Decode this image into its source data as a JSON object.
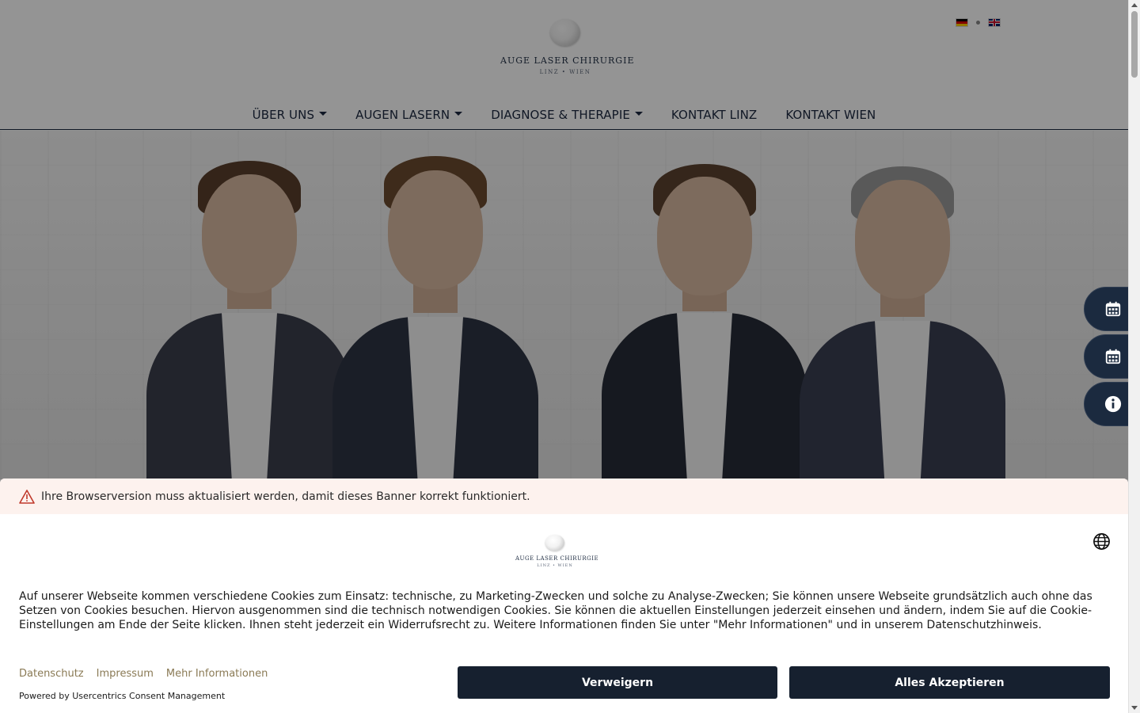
{
  "header": {
    "logo_title": "AUGE LASER CHIRURGIE",
    "logo_subtitle": "LINZ • WIEN",
    "languages": [
      {
        "code": "de",
        "icon": "german-flag-icon"
      },
      {
        "code": "en",
        "icon": "uk-flag-icon"
      }
    ]
  },
  "nav": {
    "items": [
      {
        "label": "ÜBER UNS",
        "dropdown": true
      },
      {
        "label": "AUGEN LASERN",
        "dropdown": true
      },
      {
        "label": "DIAGNOSE & THERAPIE",
        "dropdown": true
      },
      {
        "label": "KONTAKT LINZ",
        "dropdown": false
      },
      {
        "label": "KONTAKT WIEN",
        "dropdown": false
      }
    ]
  },
  "side_buttons": [
    {
      "icon": "calendar-icon"
    },
    {
      "icon": "calendar-icon"
    },
    {
      "icon": "info-icon"
    }
  ],
  "cookie_banner": {
    "warning": "Ihre Browserversion muss aktualisiert werden, damit dieses Banner korrekt funktioniert.",
    "logo_title": "AUGE LASER CHIRURGIE",
    "logo_subtitle": "LINZ • WIEN",
    "text": "Auf unserer Webseite kommen verschiedene Cookies zum Einsatz: technische, zu Marketing-Zwecken und solche zu Analyse-Zwecken; Sie können unsere Webseite grundsätzlich auch ohne das Setzen von Cookies besuchen. Hiervon ausgenommen sind die technisch notwendigen Cookies. Sie können die aktuellen Einstellungen jederzeit einsehen und ändern, indem Sie auf die Cookie-Einstellungen am Ende der Seite klicken. Ihnen steht jederzeit ein Widerrufsrecht zu. Weitere Informationen finden Sie unter \"Mehr Informationen\" und in unserem Datenschutzhinweis.",
    "links": {
      "privacy": "Datenschutz",
      "imprint": "Impressum",
      "more_info": "Mehr Informationen"
    },
    "powered_by": "Powered by Usercentrics Consent Management",
    "deny_label": "Verweigern",
    "accept_label": "Alles Akzeptieren"
  },
  "colors": {
    "navy": "#16202f",
    "link_gold": "#8a7a55",
    "warning_bg": "#fdf2ee"
  }
}
